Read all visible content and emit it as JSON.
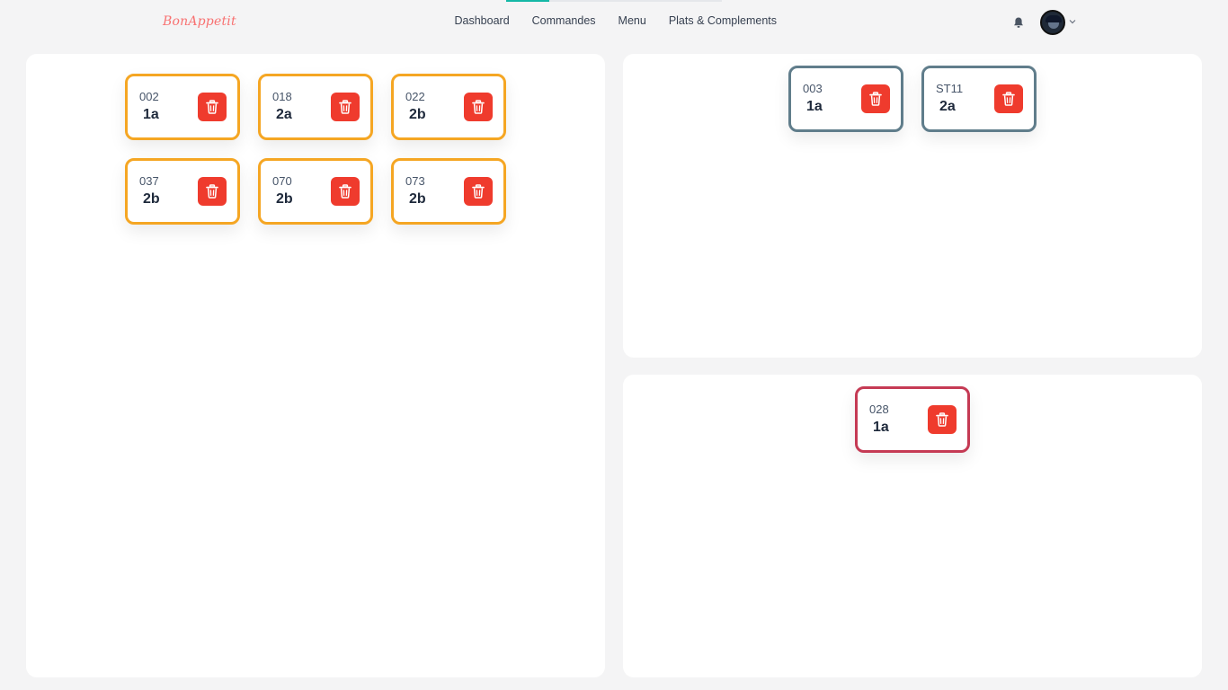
{
  "app": {
    "brand": "BonAppetit"
  },
  "nav": {
    "progress": 0.2,
    "items": [
      {
        "id": "dashboard",
        "label": "Dashboard"
      },
      {
        "id": "commandes",
        "label": "Commandes"
      },
      {
        "id": "menu",
        "label": "Menu"
      },
      {
        "id": "plats",
        "label": "Plats & Complements"
      }
    ]
  },
  "header": {
    "bell_icon": "bell-icon",
    "avatar_icon": "user-avatar",
    "chevron_icon": "chevron-down-icon"
  },
  "colors": {
    "orange": "#f5a623",
    "slate": "#607d8b",
    "red": "#c53a54",
    "delete": "#ef3b2d",
    "brand": "#f87171",
    "accent": "#14b8a6"
  },
  "panels": {
    "left": {
      "cards": [
        {
          "code": "002",
          "table": "1a"
        },
        {
          "code": "018",
          "table": "2a"
        },
        {
          "code": "022",
          "table": "2b"
        },
        {
          "code": "037",
          "table": "2b"
        },
        {
          "code": "070",
          "table": "2b"
        },
        {
          "code": "073",
          "table": "2b"
        }
      ]
    },
    "right_top": {
      "cards": [
        {
          "code": "003",
          "table": "1a"
        },
        {
          "code": "ST11",
          "table": "2a"
        }
      ]
    },
    "right_bottom": {
      "cards": [
        {
          "code": "028",
          "table": "1a"
        }
      ]
    }
  }
}
